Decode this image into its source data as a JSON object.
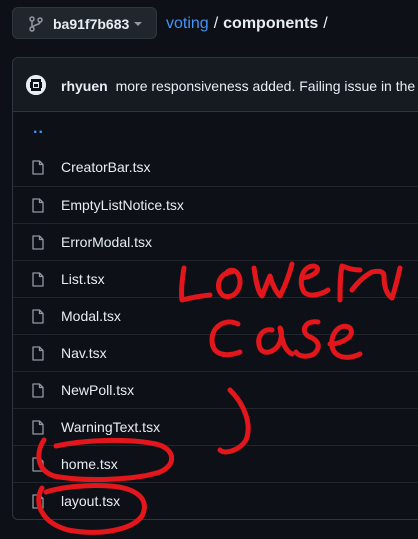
{
  "branch": {
    "name": "ba91f7b683",
    "icon": "git-branch-icon"
  },
  "breadcrumb": {
    "repo": "voting",
    "separator": "/",
    "folder": "components",
    "trailing": "/"
  },
  "commit": {
    "author": "rhyuen",
    "message": "more responsiveness added. Failing issue in the bu"
  },
  "parent_link": "..",
  "files": [
    {
      "name": "CreatorBar.tsx",
      "icon": "file-icon"
    },
    {
      "name": "EmptyListNotice.tsx",
      "icon": "file-icon"
    },
    {
      "name": "ErrorModal.tsx",
      "icon": "file-icon"
    },
    {
      "name": "List.tsx",
      "icon": "file-icon"
    },
    {
      "name": "Modal.tsx",
      "icon": "file-icon"
    },
    {
      "name": "Nav.tsx",
      "icon": "file-icon"
    },
    {
      "name": "NewPoll.tsx",
      "icon": "file-icon"
    },
    {
      "name": "WarningText.tsx",
      "icon": "file-icon"
    },
    {
      "name": "home.tsx",
      "icon": "file-icon"
    },
    {
      "name": "layout.tsx",
      "icon": "file-icon"
    }
  ],
  "annotation": {
    "text": "lower case",
    "color": "#e3161b"
  },
  "colors": {
    "link": "#4493f8",
    "background": "#0d1117",
    "border": "#30363d"
  }
}
